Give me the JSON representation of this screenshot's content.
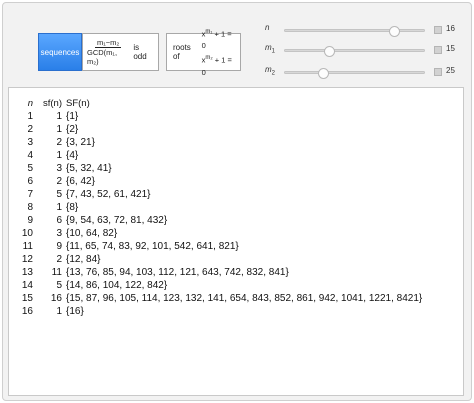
{
  "tabs": {
    "sequences": "sequences",
    "frac_num": "m₁−m₂",
    "frac_den": "GCD(m₁, m₂)",
    "frac_suffix": "is odd",
    "roots_prefix": "roots of",
    "eq1_base": "x",
    "eq1_exp": "m₁",
    "eq1_rest": " + 1 = 0",
    "eq2_base": "x",
    "eq2_exp": "m₂",
    "eq2_rest": " + 1 = 0"
  },
  "sliders": [
    {
      "label": "n",
      "sub": "",
      "value": "16",
      "level": 16,
      "max": 20
    },
    {
      "label": "m",
      "sub": "1",
      "value": "15",
      "level": 15,
      "max": 50
    },
    {
      "label": "m",
      "sub": "2",
      "value": "25",
      "level": 25,
      "max": 100
    }
  ],
  "table": {
    "headers": {
      "n": "n",
      "sf": "sf(n)",
      "set": "SF(n)"
    },
    "rows": [
      {
        "n": "1",
        "sf": "1",
        "set": "{1}"
      },
      {
        "n": "2",
        "sf": "1",
        "set": "{2}"
      },
      {
        "n": "3",
        "sf": "2",
        "set": "{3, 21}"
      },
      {
        "n": "4",
        "sf": "1",
        "set": "{4}"
      },
      {
        "n": "5",
        "sf": "3",
        "set": "{5, 32, 41}"
      },
      {
        "n": "6",
        "sf": "2",
        "set": "{6, 42}"
      },
      {
        "n": "7",
        "sf": "5",
        "set": "{7, 43, 52, 61, 421}"
      },
      {
        "n": "8",
        "sf": "1",
        "set": "{8}"
      },
      {
        "n": "9",
        "sf": "6",
        "set": "{9, 54, 63, 72, 81, 432}"
      },
      {
        "n": "10",
        "sf": "3",
        "set": "{10, 64, 82}"
      },
      {
        "n": "11",
        "sf": "9",
        "set": "{11, 65, 74, 83, 92, 101, 542, 641, 821}"
      },
      {
        "n": "12",
        "sf": "2",
        "set": "{12, 84}"
      },
      {
        "n": "13",
        "sf": "11",
        "set": "{13, 76, 85, 94, 103, 112, 121, 643, 742, 832, 841}"
      },
      {
        "n": "14",
        "sf": "5",
        "set": "{14, 86, 104, 122, 842}"
      },
      {
        "n": "15",
        "sf": "16",
        "set": "{15, 87, 96, 105, 114, 123, 132, 141, 654, 843, 852, 861, 942, 1041, 1221, 8421}"
      },
      {
        "n": "16",
        "sf": "1",
        "set": "{16}"
      }
    ]
  }
}
